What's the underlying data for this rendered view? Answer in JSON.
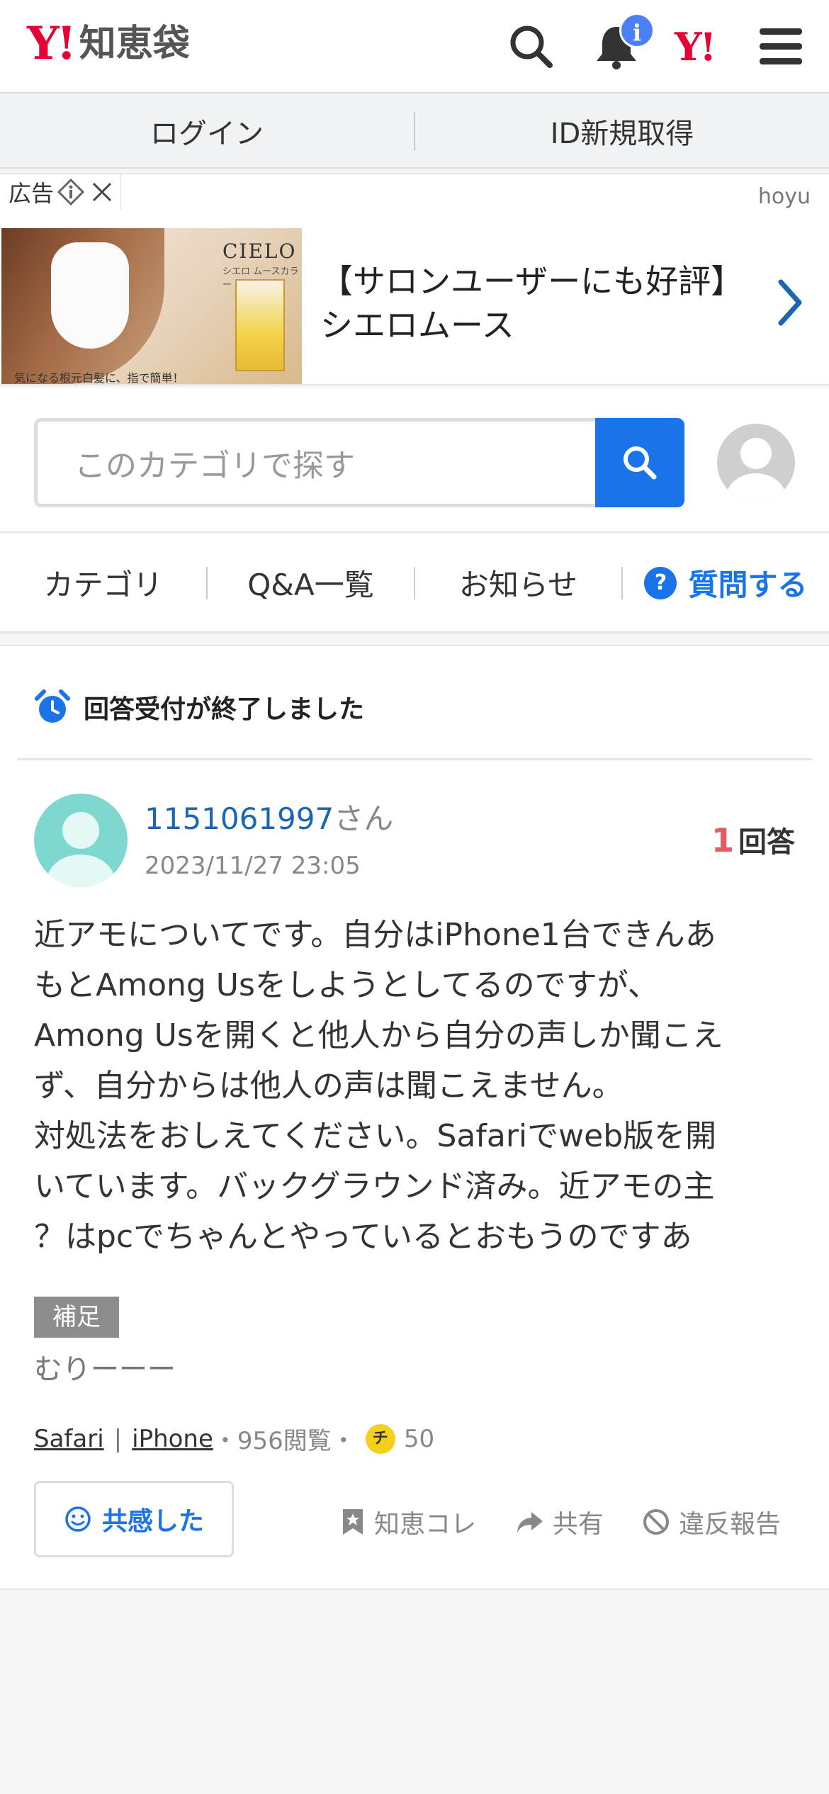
{
  "header": {
    "logo_mark": "Y!",
    "logo_text": "知恵袋",
    "notification_badge": "i",
    "yahoo_mark": "Y!"
  },
  "auth": {
    "login": "ログイン",
    "signup": "ID新規取得"
  },
  "ad": {
    "label": "広告",
    "sponsor": "hoyu",
    "brand": "CIELO",
    "brand_sub": "シエロ ムースカラー",
    "image_caption": "気になる根元白髪に、指で簡単！",
    "text_line1": "【サロンユーザーにも好評】",
    "text_line2": "シエロムース"
  },
  "search": {
    "placeholder": "このカテゴリで探す"
  },
  "tabs": {
    "category": "カテゴリ",
    "qa_list": "Q&A一覧",
    "news": "お知らせ",
    "ask": "質問する",
    "ask_icon": "?"
  },
  "question": {
    "status": "回答受付が終了しました",
    "user_id": "1151061997",
    "user_suffix": "さん",
    "date": "2023/11/27 23:05",
    "answer_count": "1",
    "answer_label": "回答",
    "body_lines": [
      "近アモについてです。自分はiPhone1台できんあ",
      "もとAmong Usをしようとしてるのですが、",
      "Among Usを開くと他人から自分の声しか聞こえ",
      "ず、自分からは他人の声は聞こえません。",
      "対処法をおしえてください。Safariでweb版を開",
      "いています。バックグラウンド済み。近アモの主",
      "？はpcでちゃんとやっているとおもうのですあ"
    ],
    "supplement_label": "補足",
    "supplement_text": "むりーーー",
    "tag1": "Safari",
    "tag2": "iPhone",
    "views": "・956閲覧・",
    "coin_label": "チ",
    "coins": "50",
    "empathy": "共感した",
    "save": "知恵コレ",
    "share": "共有",
    "report": "違反報告"
  },
  "colors": {
    "brand_red": "#e60033",
    "link_blue": "#1a73e8",
    "answer_red": "#e55a62"
  }
}
